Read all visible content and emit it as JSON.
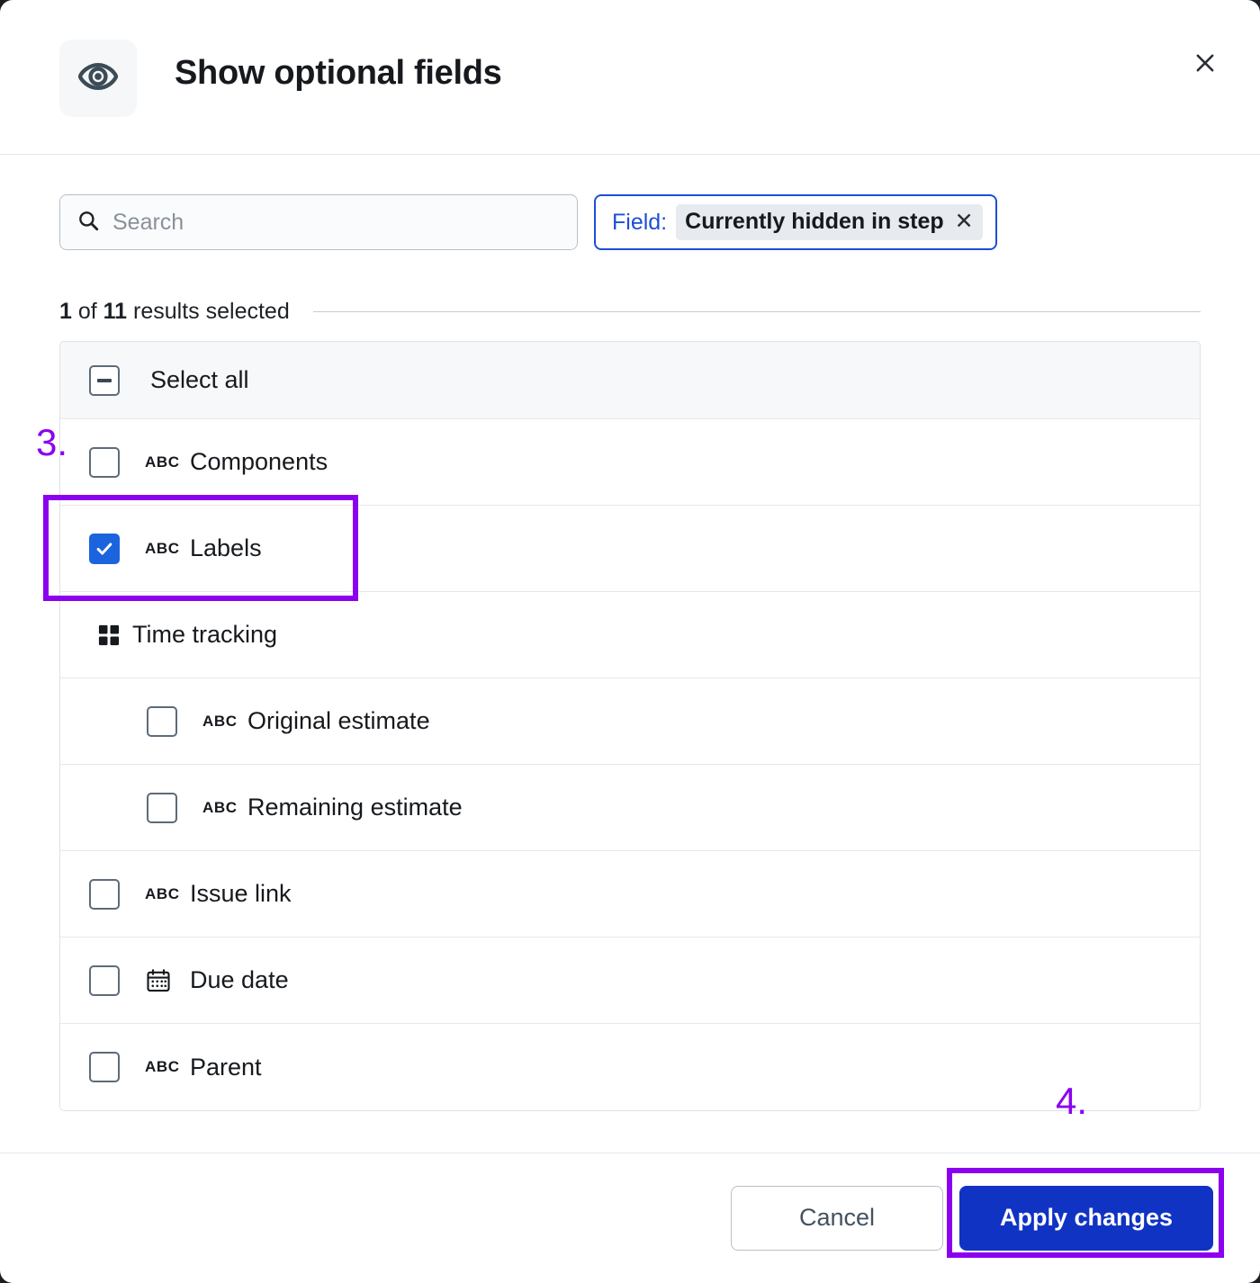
{
  "dialog": {
    "title": "Show optional fields",
    "header_icon": "eye-icon",
    "close_icon": "close-icon"
  },
  "search": {
    "placeholder": "Search",
    "value": "",
    "icon": "search-icon"
  },
  "field_filter": {
    "label": "Field:",
    "value": "Currently hidden in step",
    "remove_icon": "close-icon"
  },
  "results": {
    "selected_count": "1",
    "total_count": "11",
    "prefix": "",
    "middle": " of ",
    "suffix": " results selected"
  },
  "list": {
    "select_all_label": "Select all",
    "select_all_state": "indeterminate",
    "rows": [
      {
        "label": "Components",
        "icon": "abc-icon",
        "icon_text": "ABC",
        "checked": false,
        "indent": false
      },
      {
        "label": "Labels",
        "icon": "abc-icon",
        "icon_text": "ABC",
        "checked": true,
        "indent": false
      },
      {
        "label": "Time tracking",
        "icon": "grid-icon",
        "icon_text": "",
        "group": true
      },
      {
        "label": "Original estimate",
        "icon": "abc-icon",
        "icon_text": "ABC",
        "checked": false,
        "indent": true
      },
      {
        "label": "Remaining estimate",
        "icon": "abc-icon",
        "icon_text": "ABC",
        "checked": false,
        "indent": true
      },
      {
        "label": "Issue link",
        "icon": "abc-icon",
        "icon_text": "ABC",
        "checked": false,
        "indent": false
      },
      {
        "label": "Due date",
        "icon": "calendar-icon",
        "icon_text": "",
        "checked": false,
        "indent": false
      },
      {
        "label": "Parent",
        "icon": "abc-icon",
        "icon_text": "ABC",
        "checked": false,
        "indent": false
      }
    ]
  },
  "footer": {
    "cancel_label": "Cancel",
    "apply_label": "Apply changes"
  },
  "annotations": {
    "step3": "3.",
    "step4": "4."
  },
  "colors": {
    "accent_blue": "#1033c4",
    "checkbox_blue": "#1b64de",
    "chip_border_blue": "#1d4ed8",
    "annotation_purple": "#8a00ef",
    "header_icon": "#3b4c57"
  }
}
